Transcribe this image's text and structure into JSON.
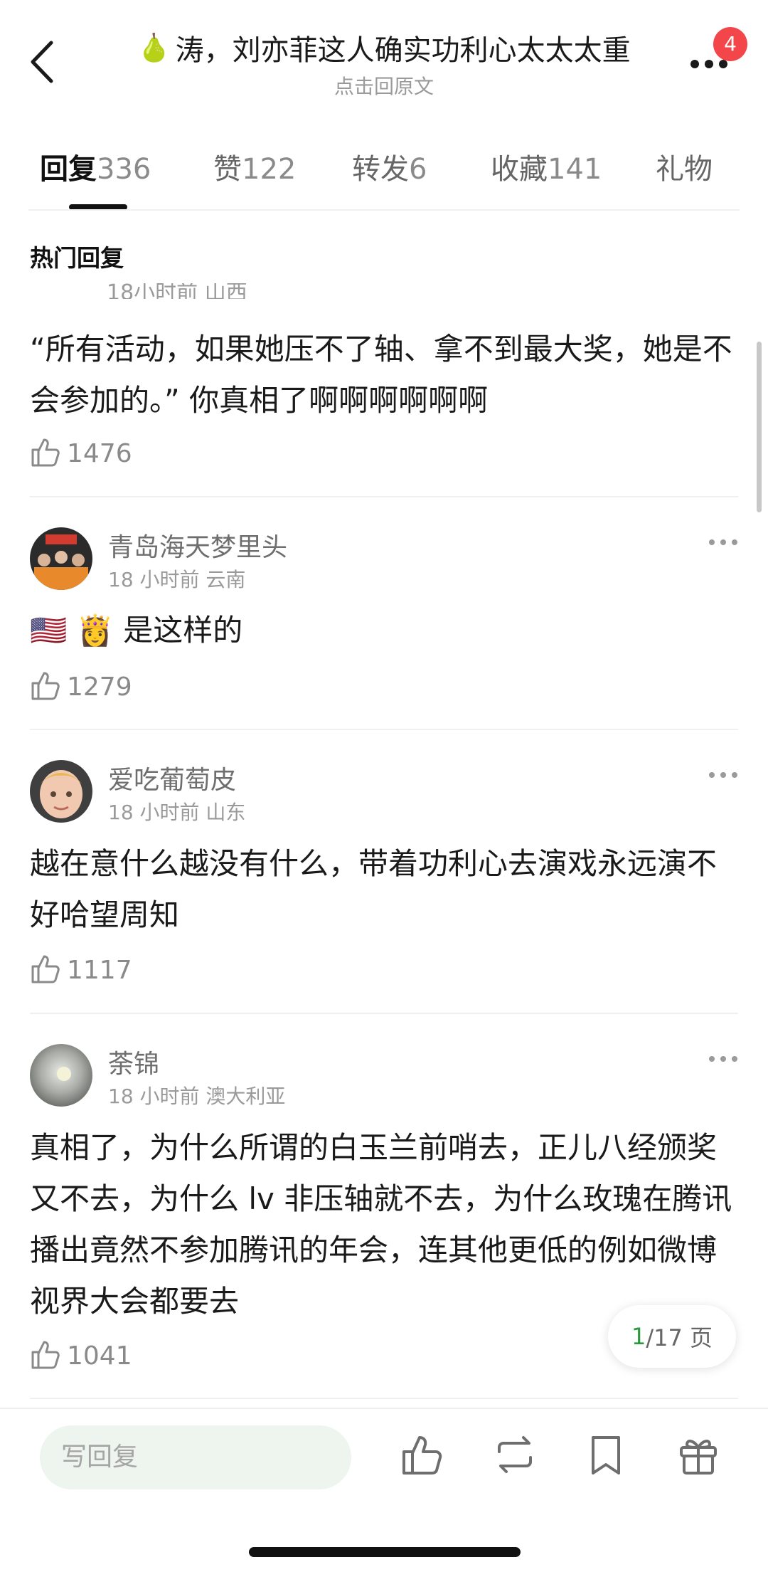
{
  "header": {
    "title_emoji": "🍐",
    "title": "涛，刘亦菲这人确实功利心太太太重",
    "subtitle": "点击回原文",
    "notification_count": "4"
  },
  "tabs": [
    {
      "label": "回复",
      "count": "336"
    },
    {
      "label": "赞",
      "count": "122"
    },
    {
      "label": "转发",
      "count": "6"
    },
    {
      "label": "收藏",
      "count": "141"
    },
    {
      "label": "礼物",
      "count": ""
    }
  ],
  "section_title": "热门回复",
  "comments": [
    {
      "meta_partial": "18小时前 山西",
      "text": "“所有活动，如果她压不了轴、拿不到最大奖，她是不会参加的。” 你真相了啊啊啊啊啊啊",
      "likes": "1476"
    },
    {
      "user": "青岛海天梦里头",
      "meta": "18 小时前  云南",
      "text": "🇺🇸 👸 是这样的",
      "likes": "1279"
    },
    {
      "user": "爱吃葡萄皮",
      "meta": "18 小时前  山东",
      "text": "越在意什么越没有什么，带着功利心去演戏永远演不好哈望周知",
      "likes": "1117"
    },
    {
      "user": "荼锦",
      "meta": "18 小时前  澳大利亚",
      "text": "真相了，为什么所谓的白玉兰前哨去，正儿八经颁奖又不去，为什么 lv 非压轴就不去，为什么玫瑰在腾讯播出竟然不参加腾讯的年会，连其他更低的例如微博视界大会都要去",
      "likes": "1041"
    }
  ],
  "pagination": {
    "current": "1",
    "total": "/17 页"
  },
  "bottom_bar": {
    "placeholder": "写回复"
  },
  "colors": {
    "badge": "#f2464b",
    "page_current": "#2b9a3e",
    "input_bg": "#eef4ee"
  },
  "icons": [
    "back-chevron-icon",
    "more-dots-icon",
    "thumbs-up-icon",
    "repost-icon",
    "bookmark-icon",
    "gift-icon"
  ]
}
